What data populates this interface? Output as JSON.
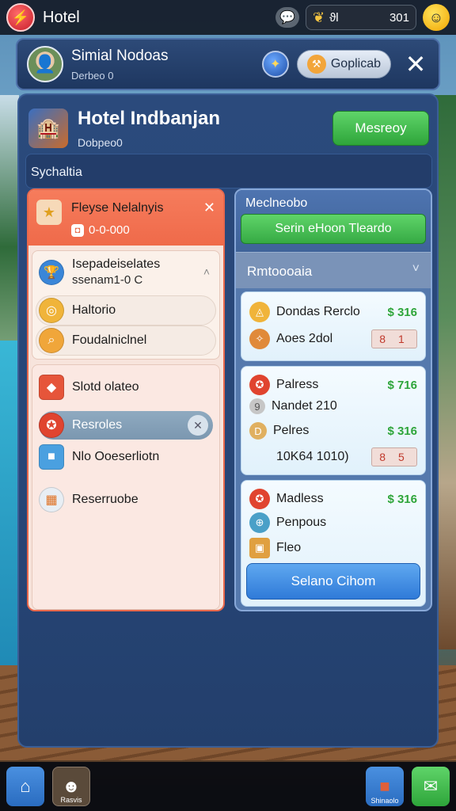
{
  "topbar": {
    "app_title": "Hotel",
    "currency_label": "ϑl",
    "currency_value": "301"
  },
  "header": {
    "name": "Simial Nodoas",
    "sub": "Derbeo 0",
    "pill_label": "Goplicab"
  },
  "hotel": {
    "name": "Hotel Indbanjan",
    "sub": "Dobpeo0",
    "action_label": "Mesreoy"
  },
  "section": {
    "label": "Sychaltia"
  },
  "left": {
    "notification": {
      "title": "Fleyse Nelalnyis",
      "sub": "0-0-000"
    },
    "group_a": [
      {
        "label": "Isepadeiselates",
        "sub": "ssenam1-0 C"
      },
      {
        "label": "Haltorio"
      },
      {
        "label": "Foudalniclnel"
      }
    ],
    "group_b": [
      {
        "label": "Slotd olateo"
      },
      {
        "label": "Resroles"
      },
      {
        "label": "Nlo Ooeserliotn"
      },
      {
        "label": "Reserruobe"
      }
    ]
  },
  "right": {
    "title": "Meclneobo",
    "green_label": "Serin eHoon Tleardo",
    "dropdown_label": "Rmtoooaia",
    "card1": [
      {
        "label": "Dondas Rerclo",
        "price": "$ 316"
      },
      {
        "label": "Aoes 2dol",
        "qty": "8 1"
      }
    ],
    "card2": [
      {
        "label": "Palress",
        "price": "$ 716"
      },
      {
        "label": "Nandet 210"
      },
      {
        "label": "Pelres",
        "price": "$ 316"
      },
      {
        "label": "10K64 1010)",
        "qty": "8 5"
      }
    ],
    "card3": [
      {
        "label": "Madless",
        "price": "$ 316"
      },
      {
        "label": "Penpous"
      },
      {
        "label": "Fleo"
      }
    ],
    "blue_label": "Selano Cihom"
  },
  "bottombar": {
    "avatar_label": "Rasvis",
    "shop_label": "Shinaolo"
  },
  "colors": {
    "accent_green": "#2ea53a",
    "panel_blue": "#274677",
    "notif_orange": "#ef6a4a",
    "price_green": "#2ea53a",
    "qty_red": "#c0392b"
  }
}
